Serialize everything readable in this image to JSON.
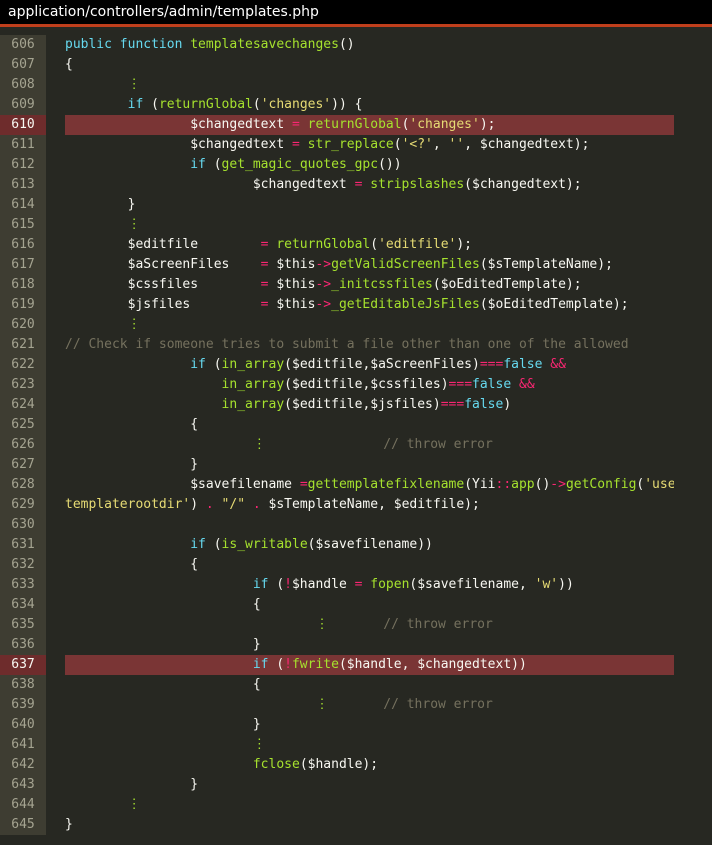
{
  "file_path": "application/controllers/admin/templates.php",
  "highlighted_lines": [
    610,
    637
  ],
  "lines": [
    {
      "no": "606",
      "tokens": [
        {
          "t": "public function ",
          "c": "kw"
        },
        {
          "t": "templatesavechanges",
          "c": "fn"
        },
        {
          "t": "()",
          "c": ""
        }
      ]
    },
    {
      "no": "607",
      "tokens": [
        {
          "t": "{",
          "c": ""
        }
      ]
    },
    {
      "no": "608",
      "tokens": [
        {
          "t": "        ",
          "c": ""
        },
        {
          "t": "⋮",
          "c": "dots"
        }
      ]
    },
    {
      "no": "609",
      "tokens": [
        {
          "t": "        ",
          "c": ""
        },
        {
          "t": "if",
          "c": "kw"
        },
        {
          "t": " (",
          "c": ""
        },
        {
          "t": "returnGlobal",
          "c": "fn"
        },
        {
          "t": "(",
          "c": ""
        },
        {
          "t": "'changes'",
          "c": "str"
        },
        {
          "t": ")) {",
          "c": ""
        }
      ]
    },
    {
      "no": "610",
      "tokens": [
        {
          "t": "                ",
          "c": ""
        },
        {
          "t": "$changedtext",
          "c": ""
        },
        {
          "t": " = ",
          "c": "op"
        },
        {
          "t": "returnGlobal",
          "c": "fn"
        },
        {
          "t": "(",
          "c": ""
        },
        {
          "t": "'changes'",
          "c": "str"
        },
        {
          "t": ");",
          "c": ""
        }
      ]
    },
    {
      "no": "611",
      "tokens": [
        {
          "t": "                ",
          "c": ""
        },
        {
          "t": "$changedtext",
          "c": ""
        },
        {
          "t": " = ",
          "c": "op"
        },
        {
          "t": "str_replace",
          "c": "fn"
        },
        {
          "t": "(",
          "c": ""
        },
        {
          "t": "'<?'",
          "c": "str"
        },
        {
          "t": ", ",
          "c": ""
        },
        {
          "t": "''",
          "c": "str"
        },
        {
          "t": ", $changedtext);",
          "c": ""
        }
      ]
    },
    {
      "no": "612",
      "tokens": [
        {
          "t": "                ",
          "c": ""
        },
        {
          "t": "if",
          "c": "kw"
        },
        {
          "t": " (",
          "c": ""
        },
        {
          "t": "get_magic_quotes_gpc",
          "c": "fn"
        },
        {
          "t": "())",
          "c": ""
        }
      ]
    },
    {
      "no": "613",
      "tokens": [
        {
          "t": "                        ",
          "c": ""
        },
        {
          "t": "$changedtext",
          "c": ""
        },
        {
          "t": " = ",
          "c": "op"
        },
        {
          "t": "stripslashes",
          "c": "fn"
        },
        {
          "t": "($changedtext);",
          "c": ""
        }
      ]
    },
    {
      "no": "614",
      "tokens": [
        {
          "t": "        }",
          "c": ""
        }
      ]
    },
    {
      "no": "615",
      "tokens": [
        {
          "t": "        ",
          "c": ""
        },
        {
          "t": "⋮",
          "c": "dots"
        }
      ]
    },
    {
      "no": "616",
      "tokens": [
        {
          "t": "        $editfile        ",
          "c": ""
        },
        {
          "t": "= ",
          "c": "op"
        },
        {
          "t": "returnGlobal",
          "c": "fn"
        },
        {
          "t": "(",
          "c": ""
        },
        {
          "t": "'editfile'",
          "c": "str"
        },
        {
          "t": ");",
          "c": ""
        }
      ]
    },
    {
      "no": "617",
      "tokens": [
        {
          "t": "        $aScreenFiles    ",
          "c": ""
        },
        {
          "t": "= ",
          "c": "op"
        },
        {
          "t": "$this",
          "c": ""
        },
        {
          "t": "->",
          "c": "op"
        },
        {
          "t": "getValidScreenFiles",
          "c": "fn"
        },
        {
          "t": "($sTemplateName);",
          "c": ""
        }
      ]
    },
    {
      "no": "618",
      "tokens": [
        {
          "t": "        $cssfiles        ",
          "c": ""
        },
        {
          "t": "= ",
          "c": "op"
        },
        {
          "t": "$this",
          "c": ""
        },
        {
          "t": "->",
          "c": "op"
        },
        {
          "t": "_initcssfiles",
          "c": "fn"
        },
        {
          "t": "($oEditedTemplate);",
          "c": ""
        }
      ]
    },
    {
      "no": "619",
      "tokens": [
        {
          "t": "        $jsfiles         ",
          "c": ""
        },
        {
          "t": "= ",
          "c": "op"
        },
        {
          "t": "$this",
          "c": ""
        },
        {
          "t": "->",
          "c": "op"
        },
        {
          "t": "_getEditableJsFiles",
          "c": "fn"
        },
        {
          "t": "($oEditedTemplate);",
          "c": ""
        }
      ]
    },
    {
      "no": "620",
      "tokens": [
        {
          "t": "        ",
          "c": ""
        },
        {
          "t": "⋮",
          "c": "dots"
        }
      ]
    },
    {
      "no": "621",
      "tokens": [
        {
          "t": "// Check if someone tries to submit a file other than one of the allowed",
          "c": "cm"
        }
      ]
    },
    {
      "no": "622",
      "tokens": [
        {
          "t": "                ",
          "c": ""
        },
        {
          "t": "if",
          "c": "kw"
        },
        {
          "t": " (",
          "c": ""
        },
        {
          "t": "in_array",
          "c": "fn"
        },
        {
          "t": "($editfile,$aScreenFiles)",
          "c": ""
        },
        {
          "t": "===",
          "c": "op"
        },
        {
          "t": "false",
          "c": "kw"
        },
        {
          "t": " &&",
          "c": "op"
        }
      ]
    },
    {
      "no": "623",
      "tokens": [
        {
          "t": "                    ",
          "c": ""
        },
        {
          "t": "in_array",
          "c": "fn"
        },
        {
          "t": "($editfile,$cssfiles)",
          "c": ""
        },
        {
          "t": "===",
          "c": "op"
        },
        {
          "t": "false",
          "c": "kw"
        },
        {
          "t": " &&",
          "c": "op"
        }
      ]
    },
    {
      "no": "624",
      "tokens": [
        {
          "t": "                    ",
          "c": ""
        },
        {
          "t": "in_array",
          "c": "fn"
        },
        {
          "t": "($editfile,$jsfiles)",
          "c": ""
        },
        {
          "t": "===",
          "c": "op"
        },
        {
          "t": "false",
          "c": "kw"
        },
        {
          "t": ")",
          "c": ""
        }
      ]
    },
    {
      "no": "625",
      "tokens": [
        {
          "t": "                {",
          "c": ""
        }
      ]
    },
    {
      "no": "626",
      "tokens": [
        {
          "t": "                        ",
          "c": ""
        },
        {
          "t": "⋮",
          "c": "dots"
        },
        {
          "t": "               // throw error",
          "c": "cm"
        }
      ]
    },
    {
      "no": "627",
      "tokens": [
        {
          "t": "                }",
          "c": ""
        }
      ]
    },
    {
      "no": "628",
      "tokens": [
        {
          "t": "                $savefilename ",
          "c": ""
        },
        {
          "t": "=",
          "c": "op"
        },
        {
          "t": "gettemplatefixlename",
          "c": "fn"
        },
        {
          "t": "(Yii",
          "c": ""
        },
        {
          "t": "::",
          "c": "op"
        },
        {
          "t": "app",
          "c": "fn"
        },
        {
          "t": "()",
          "c": ""
        },
        {
          "t": "->",
          "c": "op"
        },
        {
          "t": "getConfig",
          "c": "fn"
        },
        {
          "t": "(",
          "c": ""
        },
        {
          "t": "'user",
          "c": "str"
        }
      ]
    },
    {
      "no": "629",
      "tokens": [
        {
          "t": "templaterootdir'",
          "c": "str"
        },
        {
          "t": ") ",
          "c": ""
        },
        {
          "t": ".",
          "c": "op"
        },
        {
          "t": " ",
          "c": ""
        },
        {
          "t": "\"/\"",
          "c": "str"
        },
        {
          "t": " ",
          "c": ""
        },
        {
          "t": ".",
          "c": "op"
        },
        {
          "t": " $sTemplateName, $editfile);",
          "c": ""
        }
      ]
    },
    {
      "no": "630",
      "tokens": []
    },
    {
      "no": "631",
      "tokens": [
        {
          "t": "                ",
          "c": ""
        },
        {
          "t": "if",
          "c": "kw"
        },
        {
          "t": " (",
          "c": ""
        },
        {
          "t": "is_writable",
          "c": "fn"
        },
        {
          "t": "($savefilename))",
          "c": ""
        }
      ]
    },
    {
      "no": "632",
      "tokens": [
        {
          "t": "                {",
          "c": ""
        }
      ]
    },
    {
      "no": "633",
      "tokens": [
        {
          "t": "                        ",
          "c": ""
        },
        {
          "t": "if",
          "c": "kw"
        },
        {
          "t": " (",
          "c": ""
        },
        {
          "t": "!",
          "c": "op"
        },
        {
          "t": "$handle ",
          "c": ""
        },
        {
          "t": "=",
          "c": "op"
        },
        {
          "t": " ",
          "c": ""
        },
        {
          "t": "fopen",
          "c": "fn"
        },
        {
          "t": "($savefilename, ",
          "c": ""
        },
        {
          "t": "'w'",
          "c": "str"
        },
        {
          "t": "))",
          "c": ""
        }
      ]
    },
    {
      "no": "634",
      "tokens": [
        {
          "t": "                        {",
          "c": ""
        }
      ]
    },
    {
      "no": "635",
      "tokens": [
        {
          "t": "                                ",
          "c": ""
        },
        {
          "t": "⋮",
          "c": "dots"
        },
        {
          "t": "       // throw error",
          "c": "cm"
        }
      ]
    },
    {
      "no": "636",
      "tokens": [
        {
          "t": "                        }",
          "c": ""
        }
      ]
    },
    {
      "no": "637",
      "tokens": [
        {
          "t": "                        ",
          "c": ""
        },
        {
          "t": "if",
          "c": "kw"
        },
        {
          "t": " (",
          "c": ""
        },
        {
          "t": "!",
          "c": "op"
        },
        {
          "t": "fwrite",
          "c": "fn"
        },
        {
          "t": "($handle, $changedtext))",
          "c": ""
        }
      ]
    },
    {
      "no": "638",
      "tokens": [
        {
          "t": "                        {",
          "c": ""
        }
      ]
    },
    {
      "no": "639",
      "tokens": [
        {
          "t": "                                ",
          "c": ""
        },
        {
          "t": "⋮",
          "c": "dots"
        },
        {
          "t": "       // throw error",
          "c": "cm"
        }
      ]
    },
    {
      "no": "640",
      "tokens": [
        {
          "t": "                        }",
          "c": ""
        }
      ]
    },
    {
      "no": "641",
      "tokens": [
        {
          "t": "                        ",
          "c": ""
        },
        {
          "t": "⋮",
          "c": "dots"
        }
      ]
    },
    {
      "no": "642",
      "tokens": [
        {
          "t": "                        ",
          "c": ""
        },
        {
          "t": "fclose",
          "c": "fn"
        },
        {
          "t": "($handle);",
          "c": ""
        }
      ]
    },
    {
      "no": "643",
      "tokens": [
        {
          "t": "                }",
          "c": ""
        }
      ]
    },
    {
      "no": "644",
      "tokens": [
        {
          "t": "        ",
          "c": ""
        },
        {
          "t": "⋮",
          "c": "dots"
        }
      ]
    },
    {
      "no": "645",
      "tokens": [
        {
          "t": "}",
          "c": ""
        }
      ]
    }
  ]
}
